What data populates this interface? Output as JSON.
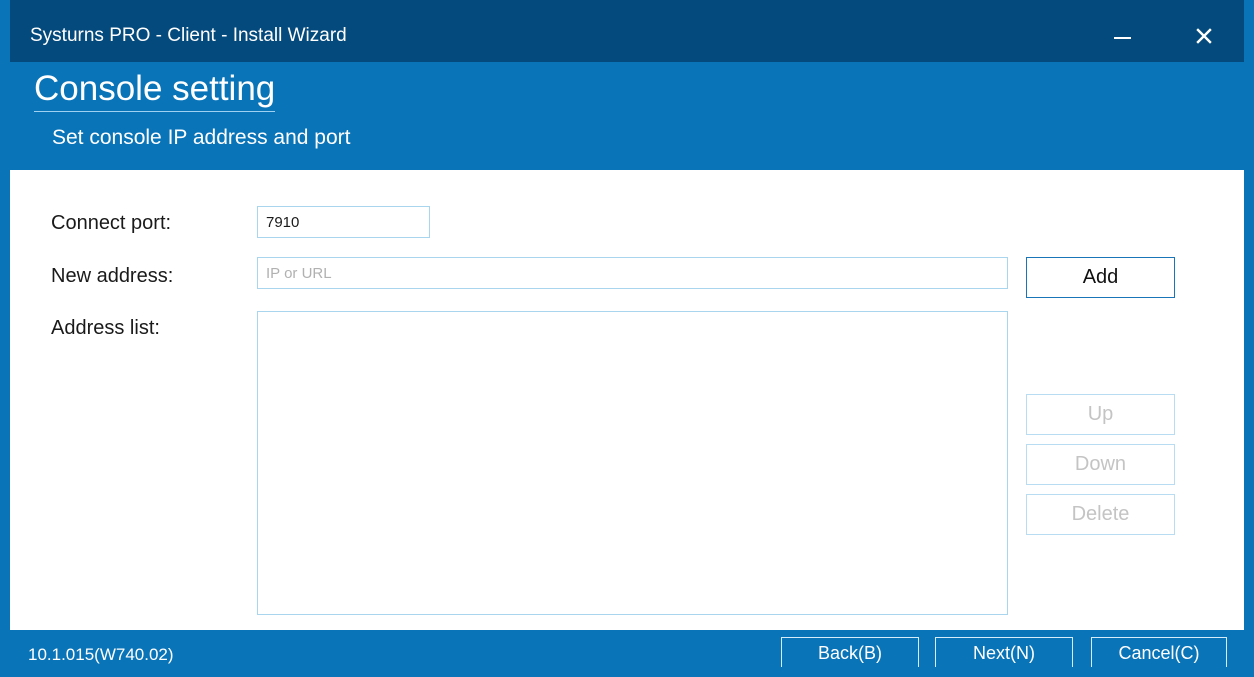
{
  "window": {
    "title": "Systurns PRO - Client  -  Install Wizard",
    "controls": {
      "minimize_icon": "minimize-icon",
      "close_icon": "close-icon"
    }
  },
  "header": {
    "title": "Console setting",
    "subtitle": "Set console IP address and port"
  },
  "form": {
    "connect_port": {
      "label": "Connect port:",
      "value": "7910"
    },
    "new_address": {
      "label": "New address:",
      "value": "",
      "placeholder": "IP or URL"
    },
    "address_list": {
      "label": "Address list:",
      "items": []
    }
  },
  "buttons": {
    "add": "Add",
    "up": "Up",
    "down": "Down",
    "delete": "Delete"
  },
  "footer": {
    "version": "10.1.015(W740.02)",
    "back": "Back(B)",
    "next": "Next(N)",
    "cancel": "Cancel(C)"
  },
  "colors": {
    "title_bar": "#054a7c",
    "accent": "#0a74b8",
    "field_border": "#a9d5ee",
    "disabled_text": "#c4c4c4"
  }
}
